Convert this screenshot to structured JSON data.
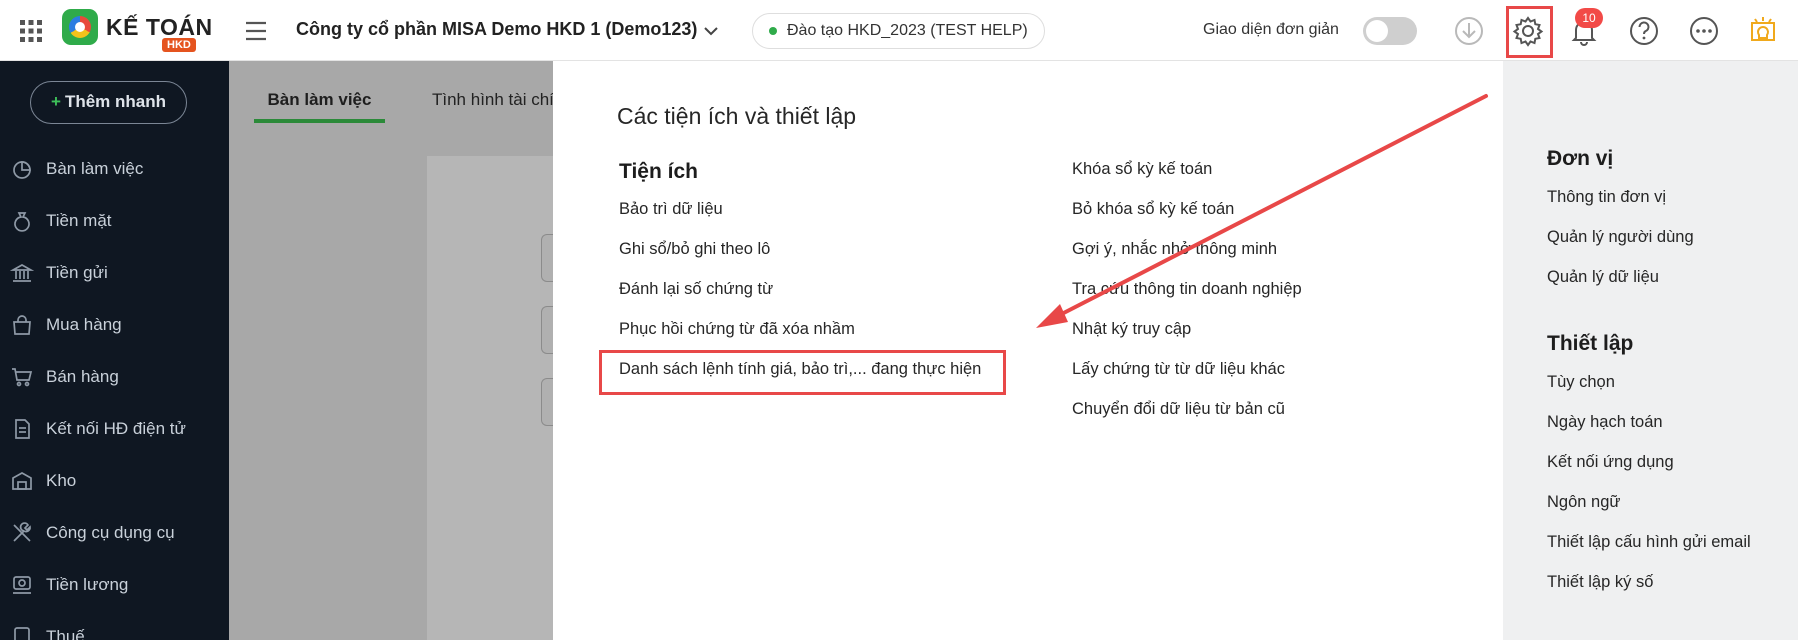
{
  "header": {
    "logo_text": "KẾ TOÁN",
    "logo_sub": "HKD",
    "company": "Công ty cổ phần MISA Demo HKD 1 (Demo123)",
    "training": "Đào tạo HKD_2023 (TEST HELP)",
    "simple_mode_label": "Giao diện đơn giản",
    "notifications_count": "10"
  },
  "sidebar": {
    "quick_add": "Thêm nhanh",
    "items": [
      {
        "label": "Bàn làm việc",
        "icon": "dashboard-icon"
      },
      {
        "label": "Tiền mặt",
        "icon": "money-bag-icon"
      },
      {
        "label": "Tiền gửi",
        "icon": "bank-icon"
      },
      {
        "label": "Mua hàng",
        "icon": "shopping-bag-icon"
      },
      {
        "label": "Bán hàng",
        "icon": "cart-icon"
      },
      {
        "label": "Kết nối HĐ điện tử",
        "icon": "invoice-icon"
      },
      {
        "label": "Kho",
        "icon": "warehouse-icon"
      },
      {
        "label": "Công cụ dụng cụ",
        "icon": "tools-icon"
      },
      {
        "label": "Tiền lương",
        "icon": "salary-icon"
      },
      {
        "label": "Thuế",
        "icon": "tax-icon"
      }
    ]
  },
  "tabs": {
    "active": "Bàn làm việc",
    "second": "Tình hình tài chính"
  },
  "panel": {
    "title": "Các tiện ích và thiết lập",
    "utilities_title": "Tiện ích",
    "col1": [
      "Bảo trì dữ liệu",
      "Ghi sổ/bỏ ghi theo lô",
      "Đánh lại số chứng từ",
      "Phục hồi chứng từ đã xóa nhầm",
      "Danh sách lệnh tính giá, bảo trì,... đang thực hiện"
    ],
    "col2": [
      "Khóa sổ kỳ kế toán",
      "Bỏ khóa sổ kỳ kế toán",
      "Gợi ý, nhắc nhở thông minh",
      "Tra cứu thông tin doanh nghiệp",
      "Nhật ký truy cập",
      "Lấy chứng từ từ dữ liệu khác",
      "Chuyển đổi dữ liệu từ bản cũ"
    ]
  },
  "right": {
    "unit_title": "Đơn vị",
    "unit_items": [
      "Thông tin đơn vị",
      "Quản lý người dùng",
      "Quản lý dữ liệu"
    ],
    "setup_title": "Thiết lập",
    "setup_items": [
      "Tùy chọn",
      "Ngày hạch toán",
      "Kết nối ứng dụng",
      "Ngôn ngữ",
      "Thiết lập cấu hình gửi email",
      "Thiết lập ký số"
    ]
  },
  "colors": {
    "brand_green": "#2fab4a",
    "highlight_red": "#e84848",
    "sidebar_bg": "#0f1722"
  }
}
